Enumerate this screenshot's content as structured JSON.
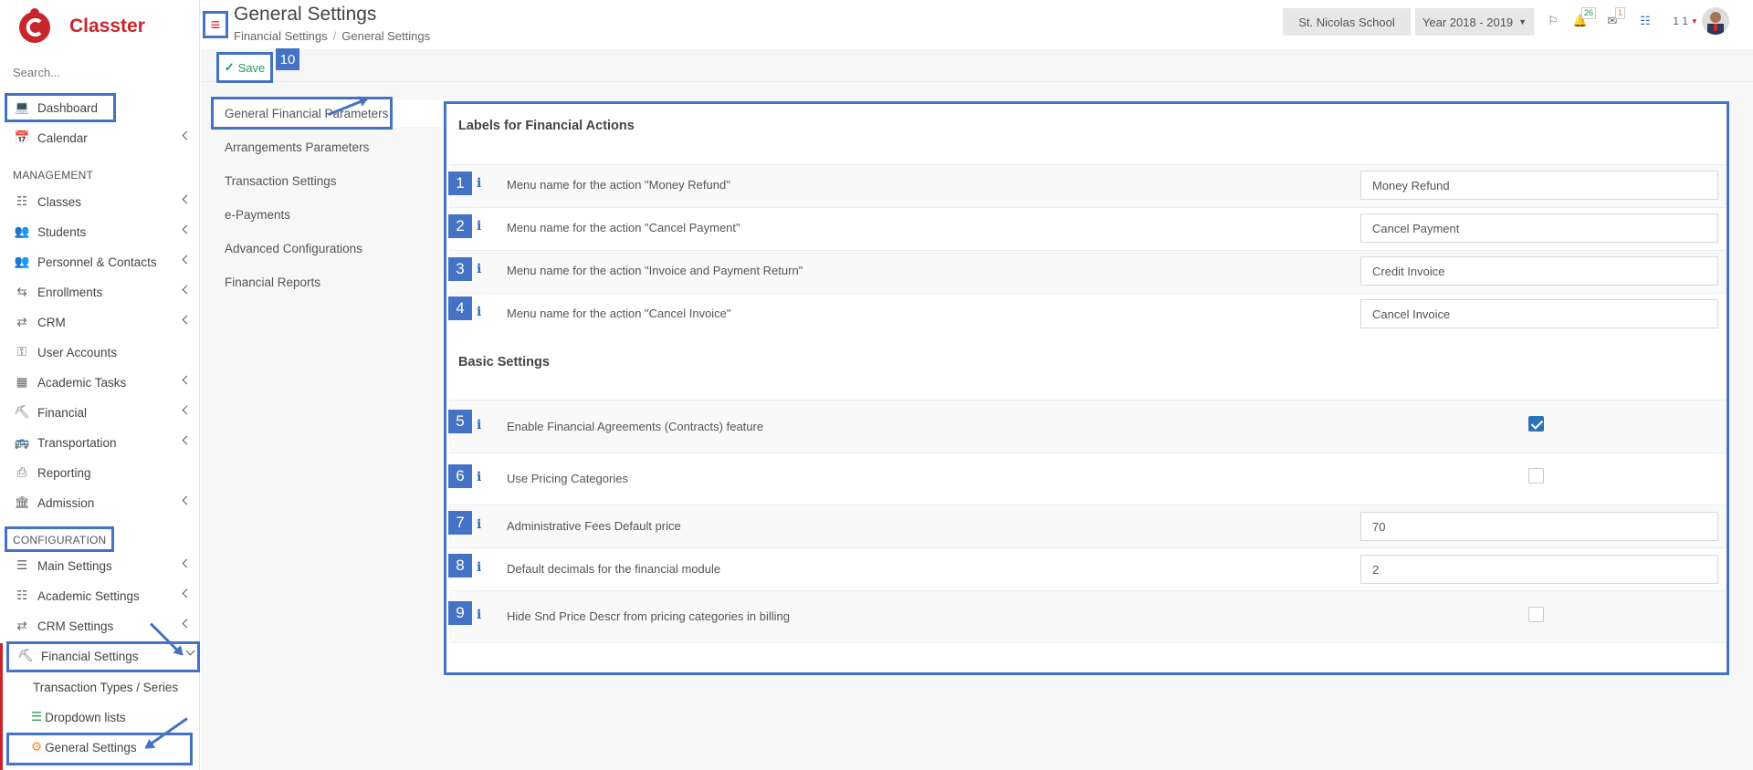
{
  "app": {
    "name": "Classter"
  },
  "sidebar": {
    "search_placeholder": "Search...",
    "items": [
      {
        "label": "Dashboard"
      },
      {
        "label": "Calendar"
      },
      {
        "label": "Classes"
      },
      {
        "label": "Students"
      },
      {
        "label": "Personnel & Contacts"
      },
      {
        "label": "Enrollments"
      },
      {
        "label": "CRM"
      },
      {
        "label": "User Accounts"
      },
      {
        "label": "Academic Tasks"
      },
      {
        "label": "Financial"
      },
      {
        "label": "Transportation"
      },
      {
        "label": "Reporting"
      },
      {
        "label": "Admission"
      }
    ],
    "management_label": "MANAGEMENT",
    "configuration_label": "CONFIGURATION",
    "config_items": [
      {
        "label": "Main Settings"
      },
      {
        "label": "Academic Settings"
      },
      {
        "label": "CRM Settings"
      },
      {
        "label": "Financial Settings"
      }
    ],
    "sub_items": [
      {
        "label": "Transaction Types / Series"
      },
      {
        "label": "Dropdown lists"
      },
      {
        "label": "General Settings"
      }
    ]
  },
  "header": {
    "title": "General Settings",
    "breadcrumb": [
      "Financial Settings",
      "General Settings"
    ],
    "school": "St. Nicolas School",
    "year": "Year 2018 - 2019",
    "notifications_count": "26",
    "messages_count": "1",
    "user_label": "1 1"
  },
  "toolbar": {
    "save_label": "Save",
    "badge_10": "10"
  },
  "tabs": [
    {
      "label": "General Financial Parameters"
    },
    {
      "label": "Arrangements Parameters"
    },
    {
      "label": "Transaction Settings"
    },
    {
      "label": "e-Payments"
    },
    {
      "label": "Advanced Configurations"
    },
    {
      "label": "Financial Reports"
    }
  ],
  "sections": {
    "labels_title": "Labels for Financial Actions",
    "basic_title": "Basic Settings"
  },
  "settings": [
    {
      "num": "1",
      "label": "Menu name for the action \"Money Refund\"",
      "value": "Money Refund"
    },
    {
      "num": "2",
      "label": "Menu name for the action \"Cancel Payment\"",
      "value": "Cancel Payment"
    },
    {
      "num": "3",
      "label": "Menu name for the action \"Invoice and Payment Return\"",
      "value": "Credit Invoice"
    },
    {
      "num": "4",
      "label": "Menu name for the action \"Cancel Invoice\"",
      "value": "Cancel Invoice"
    },
    {
      "num": "5",
      "label": "Enable Financial Agreements (Contracts) feature",
      "checked": true
    },
    {
      "num": "6",
      "label": "Use Pricing Categories",
      "checked": false
    },
    {
      "num": "7",
      "label": "Administrative Fees Default price",
      "value": "70"
    },
    {
      "num": "8",
      "label": "Default decimals for the financial module",
      "value": "2"
    },
    {
      "num": "9",
      "label": "Hide Snd Price Descr from pricing categories in billing",
      "checked": false
    }
  ],
  "colors": {
    "brand": "#c9252c",
    "annotation": "#4472c4",
    "save": "#1e9b5a",
    "checkbox": "#2d72b8"
  }
}
